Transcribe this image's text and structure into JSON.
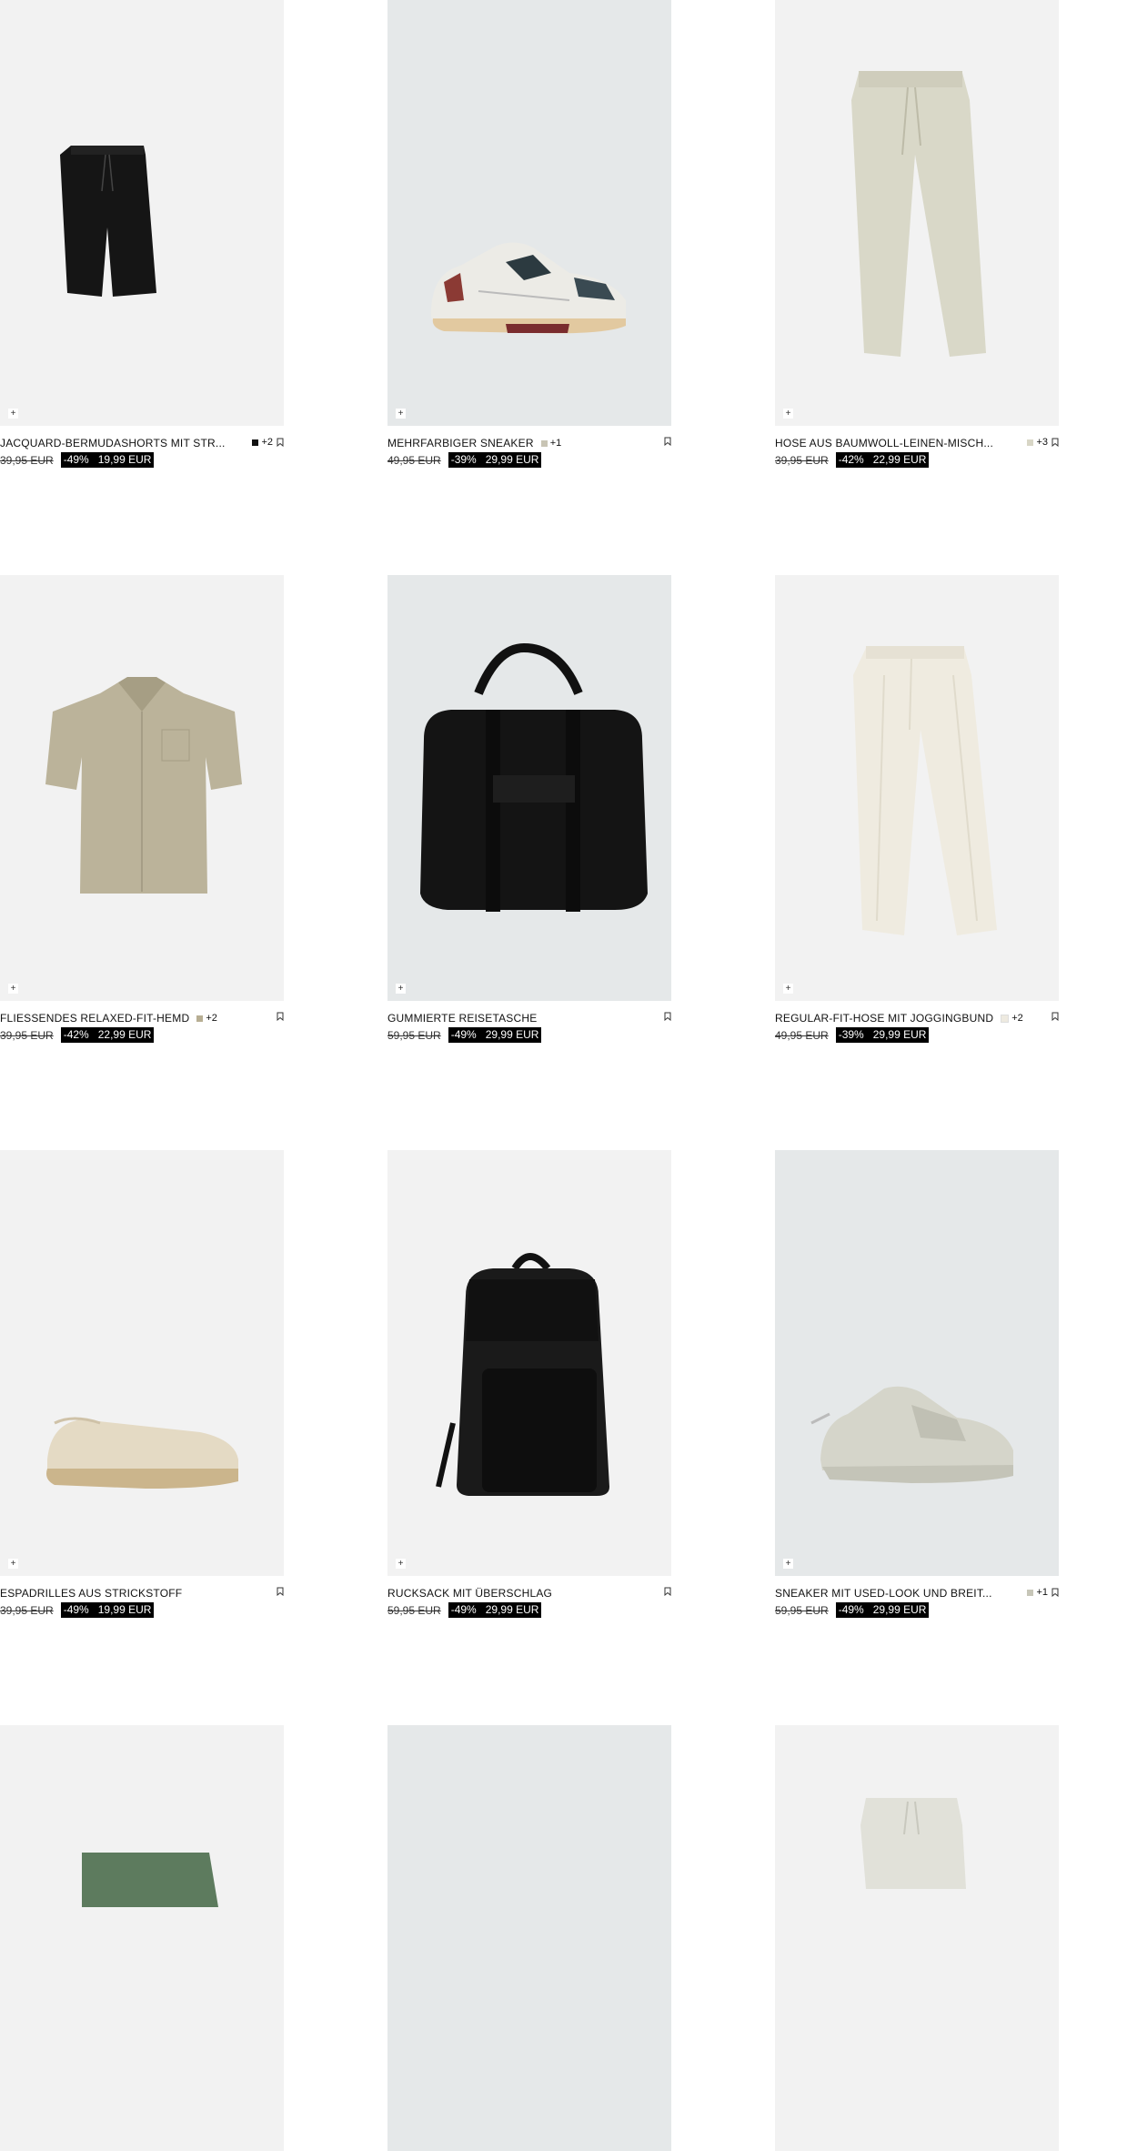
{
  "products": [
    {
      "name": "JACQUARD-BERMUDASHORTS MIT STR...",
      "colors": [
        "#111111"
      ],
      "more": "+2",
      "old_price": "39,95 EUR",
      "discount": "-49%",
      "new_price": "19,99 EUR",
      "bg": "light",
      "item": "shorts-dark"
    },
    {
      "name": "MEHRFARBIGER SNEAKER",
      "colors": [
        "#c8c4b4"
      ],
      "more": "+1",
      "old_price": "49,95 EUR",
      "discount": "-39%",
      "new_price": "29,99 EUR",
      "bg": "blue",
      "item": "sneaker-multi"
    },
    {
      "name": "HOSE AUS BAUMWOLL-LEINEN-MISCH...",
      "colors": [
        "#d8d6c6"
      ],
      "more": "+3",
      "old_price": "39,95 EUR",
      "discount": "-42%",
      "new_price": "22,99 EUR",
      "bg": "light",
      "item": "pants-beige"
    },
    {
      "name": "FLIESSENDES RELAXED-FIT-HEMD",
      "colors": [
        "#b7ae93"
      ],
      "more": "+2",
      "old_price": "39,95 EUR",
      "discount": "-42%",
      "new_price": "22,99 EUR",
      "bg": "light",
      "item": "shirt"
    },
    {
      "name": "GUMMIERTE REISETASCHE",
      "colors": [],
      "more": "",
      "old_price": "59,95 EUR",
      "discount": "-49%",
      "new_price": "29,99 EUR",
      "bg": "blue",
      "item": "travel-bag"
    },
    {
      "name": "REGULAR-FIT-HOSE MIT JOGGINGBUND",
      "colors": [
        "#eeeae0"
      ],
      "more": "+2",
      "old_price": "49,95 EUR",
      "discount": "-39%",
      "new_price": "29,99 EUR",
      "bg": "light",
      "item": "pants-cream"
    },
    {
      "name": "ESPADRILLES AUS STRICKSTOFF",
      "colors": [],
      "more": "",
      "old_price": "39,95 EUR",
      "discount": "-49%",
      "new_price": "19,99 EUR",
      "bg": "light",
      "item": "espadrille"
    },
    {
      "name": "RUCKSACK MIT ÜBERSCHLAG",
      "colors": [],
      "more": "",
      "old_price": "59,95 EUR",
      "discount": "-49%",
      "new_price": "29,99 EUR",
      "bg": "light",
      "item": "backpack"
    },
    {
      "name": "SNEAKER MIT USED-LOOK UND BREIT...",
      "colors": [
        "#c7c6b8"
      ],
      "more": "+1",
      "old_price": "59,95 EUR",
      "discount": "-49%",
      "new_price": "29,99 EUR",
      "bg": "blue",
      "item": "sneaker-used"
    },
    {
      "name": "",
      "colors": [],
      "more": "",
      "old_price": "",
      "discount": "",
      "new_price": "",
      "bg": "light",
      "item": "shorts-green"
    },
    {
      "name": "",
      "colors": [],
      "more": "",
      "old_price": "",
      "discount": "",
      "new_price": "",
      "bg": "blue",
      "item": "empty"
    },
    {
      "name": "",
      "colors": [],
      "more": "",
      "old_price": "",
      "discount": "",
      "new_price": "",
      "bg": "light",
      "item": "shorts-light"
    }
  ],
  "quick_add_symbol": "+",
  "icons": {
    "bookmark": "bookmark-icon",
    "quick_add": "plus-icon"
  }
}
